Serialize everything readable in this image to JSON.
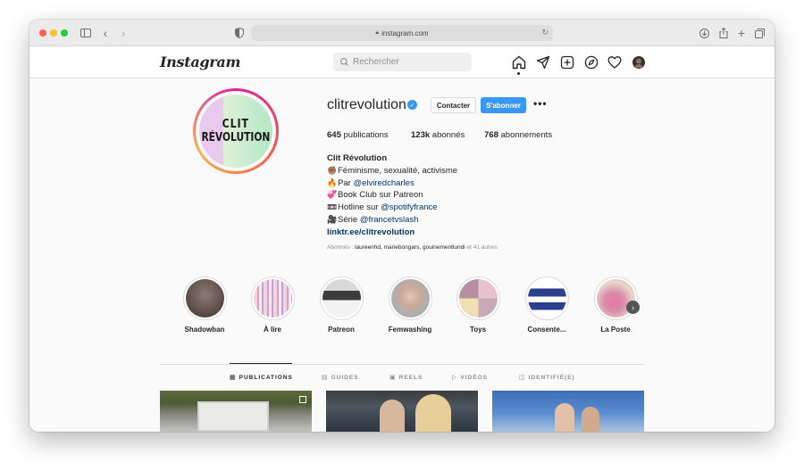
{
  "browser": {
    "url": "instagram.com"
  },
  "header": {
    "logo": "Instagram",
    "search_placeholder": "Rechercher",
    "nav_icons": [
      "home-icon",
      "direct-icon",
      "new-post-icon",
      "explore-icon",
      "activity-icon",
      "profile-avatar"
    ]
  },
  "profile": {
    "avatar_text_line1": "CLIT",
    "avatar_text_line2": "RÉVOLUTION",
    "username": "clitrevolution",
    "verified_mark": "✓",
    "contact_label": "Contacter",
    "follow_label": "S'abonner",
    "more_label": "•••",
    "stats": {
      "posts_count": "645",
      "posts_label": "publications",
      "followers_count": "123k",
      "followers_label": "abonnés",
      "following_count": "768",
      "following_label": "abonnements"
    },
    "bio": {
      "name": "Clit Révolution",
      "line1_emoji": "✊🏽",
      "line1": "Féminisme, sexualité, activisme",
      "line2_emoji": "🔥",
      "line2_prefix": "Par ",
      "line2_mention": "@elviredcharles",
      "line3_emoji": "💞",
      "line3": "Book Club sur Patreon",
      "line4_emoji": "📼",
      "line4_prefix": "Hotline sur ",
      "line4_mention": "@spotifyfrance",
      "line5_emoji": "🎥",
      "line5_prefix": "Série ",
      "line5_mention": "@francetvslash",
      "link": "linktr.ee/clitrevolution"
    },
    "followed_by_prefix": "Abonnés : ",
    "followed_by_names": "laureenhd, mariebongars, gouinementlundi",
    "followed_by_suffix": " et 41 autres"
  },
  "highlights": [
    {
      "label": "Shadowban",
      "color": "#6b5a55"
    },
    {
      "label": "À lire",
      "color": "#e9c7d6"
    },
    {
      "label": "Patreon",
      "color": "#4a4a4a"
    },
    {
      "label": "Femwashing",
      "color": "#a8b0b5"
    },
    {
      "label": "Toys",
      "color": "#c9a9b5"
    },
    {
      "label": "Consente...",
      "color": "#2c3f8f"
    },
    {
      "label": "La Poste",
      "color": "#d98aa8"
    }
  ],
  "tabs": [
    {
      "label": "PUBLICATIONS",
      "icon": "grid-icon",
      "active": true
    },
    {
      "label": "GUIDES",
      "icon": "guide-icon",
      "active": false
    },
    {
      "label": "REELS",
      "icon": "reels-icon",
      "active": false
    },
    {
      "label": "VIDÉOS",
      "icon": "video-icon",
      "active": false
    },
    {
      "label": "IDENTIFIÉ(E)",
      "icon": "tagged-icon",
      "active": false
    }
  ],
  "colors": {
    "accent": "#3897f0",
    "text": "#262626",
    "muted": "#8e8e8e",
    "mention": "#00376b"
  }
}
